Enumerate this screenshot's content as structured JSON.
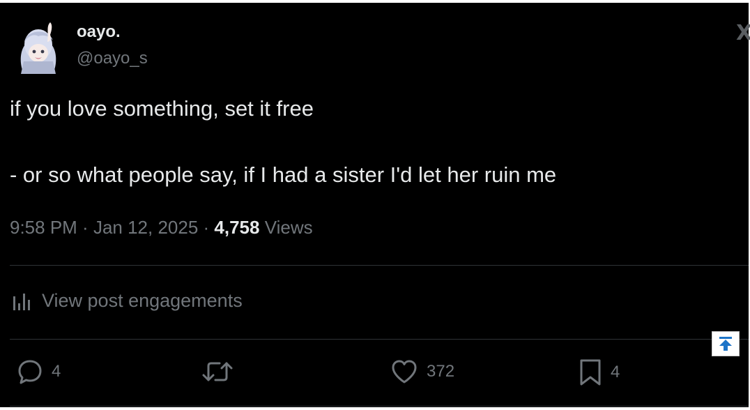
{
  "author": {
    "display_name": "oayo.",
    "handle": "@oayo_s"
  },
  "logo_icon": "x-logo-icon",
  "post": {
    "line1": "if you love something, set it free",
    "line2": "- or so what people say, if I had a sister I'd let her ruin me"
  },
  "meta": {
    "time": "9:58 PM",
    "separator": " · ",
    "date": "Jan 12, 2025",
    "views_count": "4,758",
    "views_label": " Views"
  },
  "engagements": {
    "label": "View post engagements",
    "icon": "bar-chart-icon"
  },
  "actions": {
    "replies": "4",
    "reposts": "",
    "likes": "372",
    "bookmarks": "4"
  },
  "colors": {
    "background": "#000000",
    "text_primary": "#e7e9ea",
    "text_secondary": "#71767b",
    "divider": "#2f3336",
    "scroll_top_arrow": "#1d74c8"
  }
}
